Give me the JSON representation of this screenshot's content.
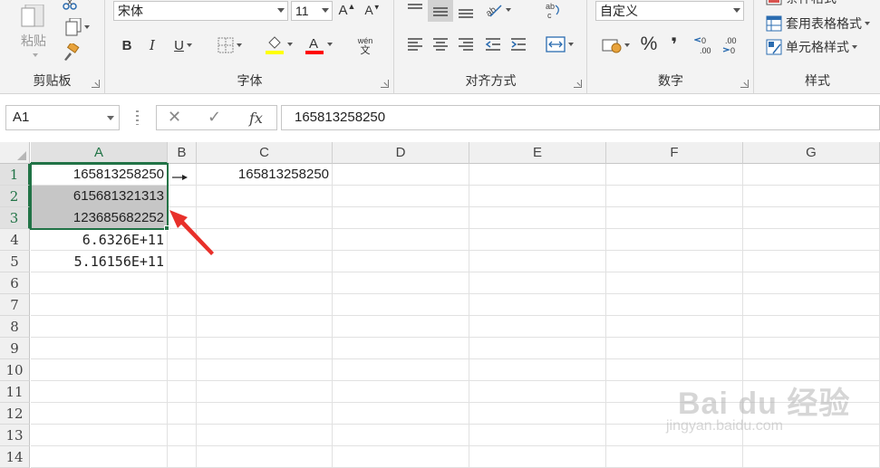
{
  "ribbon": {
    "clipboard": {
      "label": "剪贴板",
      "paste": "粘贴"
    },
    "font": {
      "label": "字体",
      "name": "宋体",
      "size": "11",
      "bold": "B",
      "italic": "I",
      "underline": "U",
      "wen": "wén",
      "wen_char": "文"
    },
    "align": {
      "label": "对齐方式"
    },
    "number": {
      "label": "数字",
      "format": "自定义",
      "percent": "%",
      "comma": "❜",
      "inc": "←0\n.00",
      "dec": ".00\n→0"
    },
    "styles": {
      "label": "样式",
      "cond": "条件格式",
      "table": "套用表格格式",
      "cell": "单元格样式"
    }
  },
  "formula_bar": {
    "name_box": "A1",
    "fx": "fx",
    "value": "165813258250"
  },
  "columns": [
    "A",
    "B",
    "C",
    "D",
    "E",
    "F",
    "G"
  ],
  "rows": [
    "1",
    "2",
    "3",
    "4",
    "5",
    "6",
    "7",
    "8",
    "9",
    "10",
    "11",
    "12",
    "13",
    "14"
  ],
  "cells": {
    "A1": "165813258250",
    "A2": "615681321313",
    "A3": "123685682252",
    "A4": "6.6326E+11",
    "A5": "5.16156E+11",
    "C1": "165813258250"
  },
  "annotation": {
    "arrow_color": "#e8302a"
  },
  "watermark": {
    "logo": "Bai du 经验",
    "url": "jingyan.baidu.com"
  },
  "colors": {
    "accent": "#217346",
    "font_underline": "#ff0000",
    "highlight": "#ffff00"
  }
}
